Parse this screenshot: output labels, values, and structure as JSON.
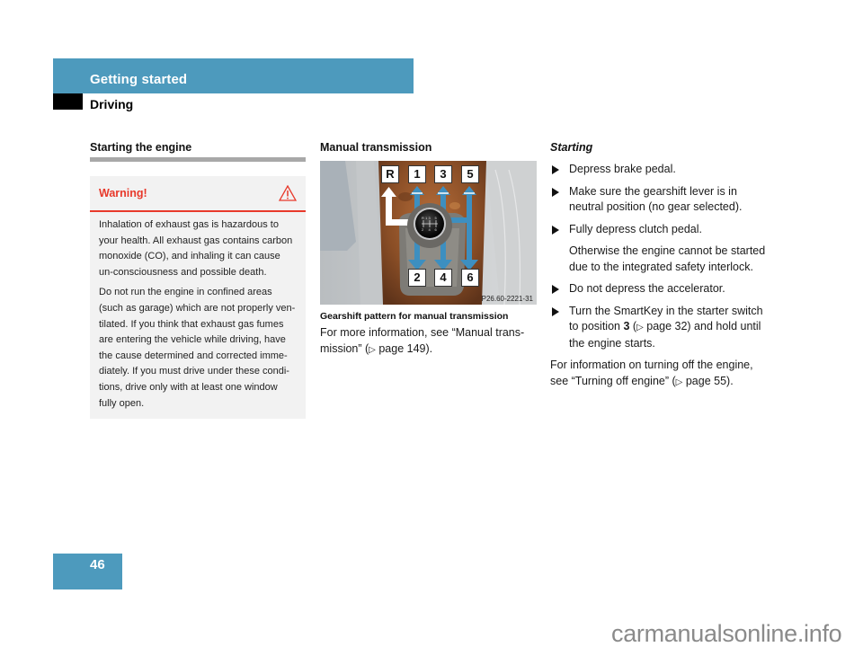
{
  "header": {
    "chapter": "Getting started",
    "section": "Driving"
  },
  "column1": {
    "title": "Starting the engine",
    "warning": {
      "label": "Warning!",
      "icon": "warning-triangle-icon",
      "paragraphs": [
        "Inhalation of exhaust gas is hazardous to your health. All exhaust gas contains carbon monoxide (CO), and inhaling it can cause un-consciousness and possible death.",
        "Do not run the engine in confined areas (such as garage) which are not properly ven-tilated. If you think that exhaust gas fumes are entering the vehicle while driving, have the cause determined and corrected imme-diately. If you must drive under these condi-tions, drive only with at least one window fully open."
      ]
    }
  },
  "column2": {
    "title": "Manual transmission",
    "figure": {
      "gears_top": [
        "R",
        "1",
        "3",
        "5"
      ],
      "gears_bottom": [
        "2",
        "4",
        "6"
      ],
      "code": "P26.60-2221-31",
      "caption": "Gearshift pattern for manual transmission"
    },
    "text_before": "For more information, see “Manual trans-mission” (",
    "xref_symbol": "▷",
    "xref_page": " page 149).",
    "arrow_color": "#3d8fc0"
  },
  "column3": {
    "subtitle": "Starting",
    "steps": [
      "Depress brake pedal.",
      "Make sure the gearshift lever is in neutral position (no gear selected).",
      "Fully depress clutch pedal."
    ],
    "step3_note": "Otherwise the engine cannot be started due to the integrated safety interlock.",
    "step4": "Do not depress the accelerator.",
    "step5": {
      "pre": "Turn the SmartKey in the starter switch to position ",
      "position": "3",
      "mid": " (",
      "xref_symbol": "▷",
      "post": " page 32) and hold until the engine starts."
    },
    "closing": {
      "pre": "For information on turning off the engine, see “Turning off engine” (",
      "xref_symbol": "▷",
      "post": " page 55)."
    }
  },
  "footer": {
    "page_number": "46",
    "watermark": "carmanualsonline.info"
  },
  "colors": {
    "brand_blue": "#4d9abd",
    "warning_red": "#e8392b"
  }
}
